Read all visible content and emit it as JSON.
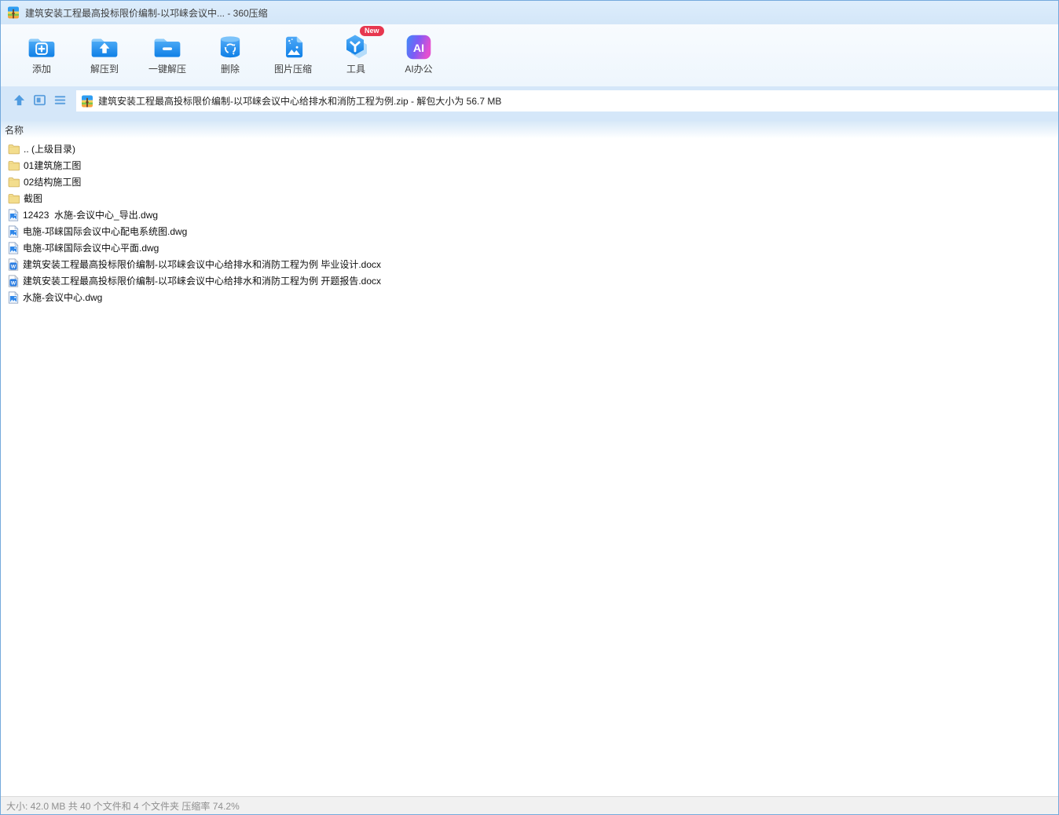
{
  "window": {
    "title": "建筑安装工程最高投标限价编制-以邛崃会议中... - 360压缩"
  },
  "toolbar": {
    "items": [
      {
        "name": "add-button",
        "icon": "add-folder-icon",
        "label": "添加"
      },
      {
        "name": "extract-to-button",
        "icon": "extract-to-icon",
        "label": "解压到"
      },
      {
        "name": "one-click-extract-button",
        "icon": "one-click-extract-icon",
        "label": "一键解压"
      },
      {
        "name": "delete-button",
        "icon": "delete-icon",
        "label": "删除"
      },
      {
        "name": "image-compress-button",
        "icon": "image-compress-icon",
        "label": "图片压缩"
      },
      {
        "name": "tools-button",
        "icon": "tools-icon",
        "label": "工具",
        "badge": "New"
      },
      {
        "name": "ai-office-button",
        "icon": "ai-office-icon",
        "label": "AI办公"
      }
    ]
  },
  "navbar": {
    "buttons": [
      {
        "name": "up-button",
        "icon": "up-icon"
      },
      {
        "name": "view-mode-button",
        "icon": "view-mode-icon"
      },
      {
        "name": "list-view-button",
        "icon": "list-view-icon"
      }
    ],
    "address": "建筑安装工程最高投标限价编制-以邛崃会议中心给排水和消防工程为例.zip - 解包大小为 56.7 MB"
  },
  "list": {
    "column_header": "名称",
    "items": [
      {
        "name": ".. (上级目录)",
        "type": "folder",
        "icon": "folder-icon"
      },
      {
        "name": "01建筑施工图",
        "type": "folder",
        "icon": "folder-icon"
      },
      {
        "name": "02结构施工图",
        "type": "folder",
        "icon": "folder-icon"
      },
      {
        "name": "截图",
        "type": "folder",
        "icon": "folder-icon"
      },
      {
        "name": "12423  水施-会议中心_导出.dwg",
        "type": "dwg",
        "icon": "dwg-file-icon"
      },
      {
        "name": "电施-邛崃国际会议中心配电系统图.dwg",
        "type": "dwg",
        "icon": "dwg-file-icon"
      },
      {
        "name": "电施-邛崃国际会议中心平面.dwg",
        "type": "dwg",
        "icon": "dwg-file-icon"
      },
      {
        "name": "建筑安装工程最高投标限价编制-以邛崃会议中心给排水和消防工程为例 毕业设计.docx",
        "type": "docx",
        "icon": "docx-file-icon"
      },
      {
        "name": "建筑安装工程最高投标限价编制-以邛崃会议中心给排水和消防工程为例 开题报告.docx",
        "type": "docx",
        "icon": "docx-file-icon"
      },
      {
        "name": "水施-会议中心.dwg",
        "type": "dwg",
        "icon": "dwg-file-icon"
      }
    ]
  },
  "statusbar": {
    "text": "大小: 42.0 MB 共 40 个文件和 4 个文件夹 压缩率 74.2%"
  },
  "colors": {
    "accent_blue": "#1286ea",
    "titlebar_bg": "#d7e8fa",
    "badge_red": "#e7374f",
    "folder_yellow": "#f3dd8d",
    "status_gray": "#8f8f8f"
  }
}
